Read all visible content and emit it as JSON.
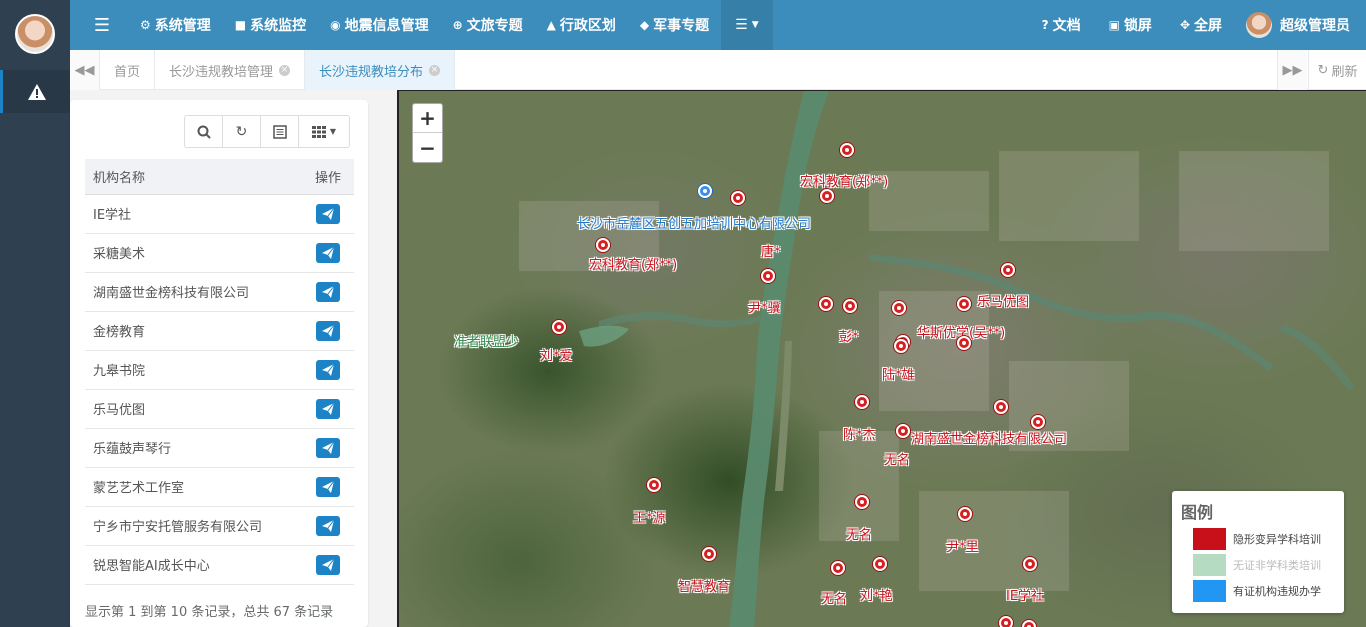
{
  "sidebar": {
    "items": [
      {
        "icon": "warning-icon"
      }
    ]
  },
  "topnav": {
    "items": [
      {
        "label": "系统管理",
        "icon": "gear-icon"
      },
      {
        "label": "系统监控",
        "icon": "video-camera-icon"
      },
      {
        "label": "地震信息管理",
        "icon": "map-pin-icon"
      },
      {
        "label": "文旅专题",
        "icon": "globe-icon"
      },
      {
        "label": "行政区划",
        "icon": "bank-icon"
      },
      {
        "label": "军事专题",
        "icon": "shield-icon"
      }
    ],
    "right": [
      {
        "label": "文档",
        "icon": "question-circle-icon"
      },
      {
        "label": "锁屏",
        "icon": "lock-icon"
      },
      {
        "label": "全屏",
        "icon": "expand-icon"
      }
    ],
    "user": "超级管理员"
  },
  "tabs": [
    {
      "label": "首页"
    },
    {
      "label": "长沙违规教培管理"
    },
    {
      "label": "长沙违规教培分布"
    }
  ],
  "refresh_label": "刷新",
  "table": {
    "headers": {
      "name": "机构名称",
      "op": "操作"
    },
    "rows": [
      "IE学社",
      "采糖美术",
      "湖南盛世金榜科技有限公司",
      "金榜教育",
      "九皋书院",
      "乐马优图",
      "乐蕴鼓声琴行",
      "蒙艺艺术工作室",
      "宁乡市宁安托管服务有限公司",
      "锐思智能AI成长中心"
    ],
    "pager": "显示第 1 到第 10 条记录，总共 67 条记录"
  },
  "map": {
    "zoom_in": "+",
    "zoom_out": "−",
    "markers": [
      {
        "label": "宏科教育(郑**)",
        "color": "red"
      },
      {
        "label": "长沙市岳麓区五创五加培训中心有限公司",
        "color": "blue"
      },
      {
        "label": "宏科教育(郑**)",
        "color": "red"
      },
      {
        "label": "唐*",
        "color": "red"
      },
      {
        "label": "尹*骥",
        "color": "red"
      },
      {
        "label": "彭*",
        "color": "red"
      },
      {
        "label": "乐马优图",
        "color": "red"
      },
      {
        "label": "华斯优学(吴**)",
        "color": "red"
      },
      {
        "label": "陆*雄",
        "color": "red"
      },
      {
        "label": "准者联盟少",
        "color": "green"
      },
      {
        "label": "刘*爱",
        "color": "red"
      },
      {
        "label": "陈*杰",
        "color": "red"
      },
      {
        "label": "湖南盛世金榜科技有限公司",
        "color": "red"
      },
      {
        "label": "无名",
        "color": "red"
      },
      {
        "label": "王*源",
        "color": "red"
      },
      {
        "label": "无名",
        "color": "red"
      },
      {
        "label": "尹*里",
        "color": "red"
      },
      {
        "label": "智慧教育",
        "color": "red"
      },
      {
        "label": "无名",
        "color": "red"
      },
      {
        "label": "刘*艳",
        "color": "red"
      },
      {
        "label": "IE学社",
        "color": "red"
      }
    ],
    "legend": {
      "title": "图例",
      "items": [
        {
          "label": "隐形变异学科培训",
          "color": "#c8101a"
        },
        {
          "label": "无证非学科类培训",
          "color": "#b5dcc2"
        },
        {
          "label": "有证机构违规办学",
          "color": "#2196f3"
        }
      ]
    }
  }
}
